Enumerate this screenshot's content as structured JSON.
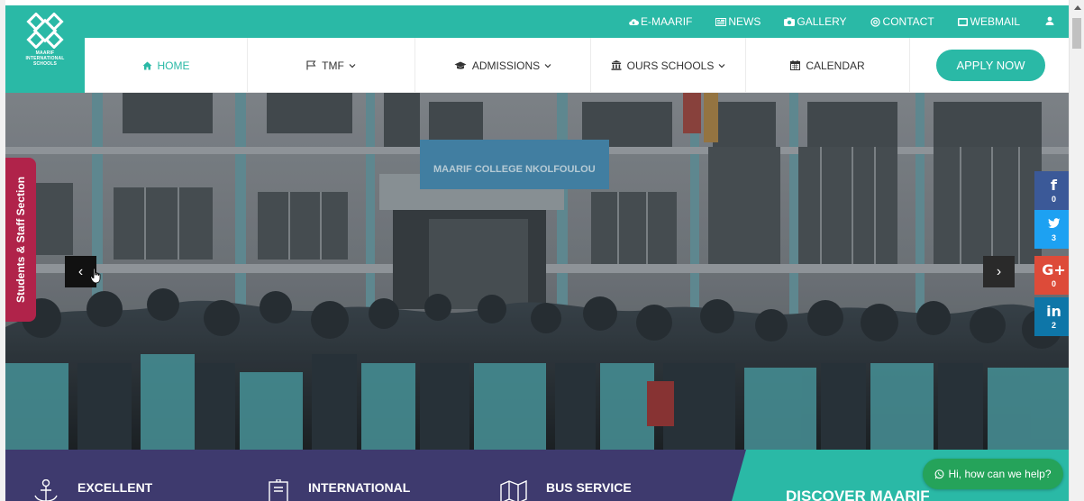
{
  "logo": {
    "text_line1": "MAARIF",
    "text_line2": "INTERNATIONAL",
    "text_line3": "SCHOOLS"
  },
  "topbar": {
    "links": [
      {
        "label": "E-MAARIF",
        "icon": "cloud-icon"
      },
      {
        "label": "NEWS",
        "icon": "newspaper-icon"
      },
      {
        "label": "GALLERY",
        "icon": "camera-icon"
      },
      {
        "label": "CONTACT",
        "icon": "at-icon"
      },
      {
        "label": "WEBMAIL",
        "icon": "envelope-icon"
      }
    ],
    "user_icon": "user-icon"
  },
  "nav": {
    "items": [
      {
        "label": "HOME",
        "icon": "home-icon"
      },
      {
        "label": "TMF",
        "icon": "flag-icon",
        "dropdown": true
      },
      {
        "label": "ADMISSIONS",
        "icon": "graduation-cap-icon",
        "dropdown": true
      },
      {
        "label": "OURS SCHOOLS",
        "icon": "institution-icon",
        "dropdown": true
      },
      {
        "label": "CALENDAR",
        "icon": "calendar-icon"
      }
    ],
    "apply_label": "APPLY NOW"
  },
  "hero": {
    "staff_tab": "Students & Staff Section",
    "sign_line1": "MAARIF COLLEGE NKOLFOULOU",
    "prev": "‹",
    "next": "›"
  },
  "social": [
    {
      "glyph": "f",
      "count": "0",
      "name": "facebook"
    },
    {
      "glyph": "🐦",
      "count": "3",
      "name": "twitter"
    },
    {
      "glyph": "G+",
      "count": "0",
      "name": "google-plus"
    },
    {
      "glyph": "in",
      "count": "2",
      "name": "linkedin"
    }
  ],
  "features": [
    {
      "label": "EXCELLENT",
      "icon": "anchor-icon"
    },
    {
      "label": "INTERNATIONAL",
      "icon": "certificate-icon"
    },
    {
      "label": "BUS SERVICE",
      "icon": "map-icon"
    }
  ],
  "discover": {
    "label": "DISCOVER MAARIF"
  },
  "chat": {
    "label": "Hi, how can we help?"
  },
  "colors": {
    "teal": "#2ab9a6",
    "navy": "#3e3a6e",
    "staff_red": "#b0234a",
    "whatsapp": "#25a35a"
  }
}
